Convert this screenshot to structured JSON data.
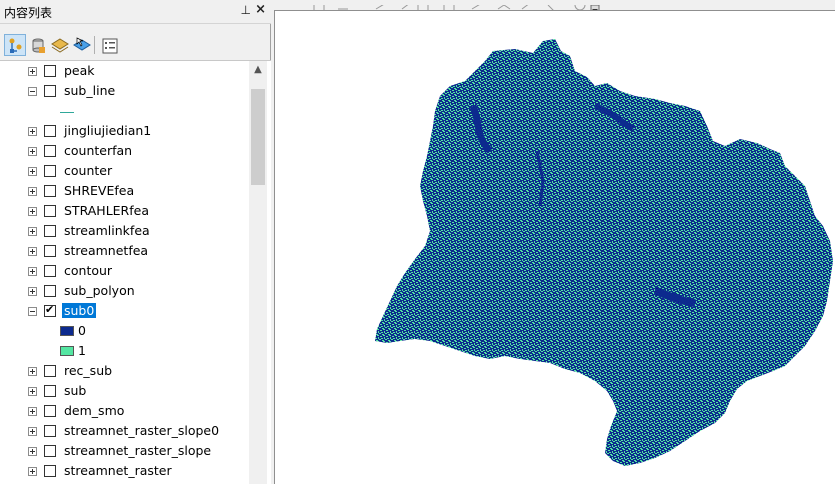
{
  "toc": {
    "title": "内容列表",
    "pin_icon": "pin-icon",
    "close_icon": "close-icon",
    "toolbar": [
      {
        "name": "list-by-drawing-order",
        "icon": "drawing-order-icon",
        "active": true
      },
      {
        "name": "list-by-source",
        "icon": "source-icon"
      },
      {
        "name": "list-by-visibility",
        "icon": "visibility-icon"
      },
      {
        "name": "list-by-selection",
        "icon": "selection-icon"
      },
      {
        "name": "options",
        "icon": "options-icon"
      }
    ],
    "layers": [
      {
        "name": "peak",
        "expanded": false,
        "checked": false
      },
      {
        "name": "sub_line",
        "expanded": true,
        "checked": false
      },
      {
        "name": "jingliujiedian1",
        "expanded": false,
        "checked": false
      },
      {
        "name": "counterfan",
        "expanded": false,
        "checked": false
      },
      {
        "name": "counter",
        "expanded": false,
        "checked": false
      },
      {
        "name": "SHREVEfea",
        "expanded": false,
        "checked": false
      },
      {
        "name": "STRAHLERfea",
        "expanded": false,
        "checked": false
      },
      {
        "name": "streamlinkfea",
        "expanded": false,
        "checked": false
      },
      {
        "name": "streamnetfea",
        "expanded": false,
        "checked": false
      },
      {
        "name": "contour",
        "expanded": false,
        "checked": false
      },
      {
        "name": "sub_polyon",
        "expanded": false,
        "checked": false
      },
      {
        "name": "sub0",
        "expanded": true,
        "checked": true,
        "selected": true
      },
      {
        "name": "rec_sub",
        "expanded": false,
        "checked": false
      },
      {
        "name": "sub",
        "expanded": false,
        "checked": false
      },
      {
        "name": "dem_smo",
        "expanded": false,
        "checked": false
      },
      {
        "name": "streamnet_raster_slope0",
        "expanded": false,
        "checked": false
      },
      {
        "name": "streamnet_raster_slope",
        "expanded": false,
        "checked": false
      },
      {
        "name": "streamnet_raster",
        "expanded": false,
        "checked": false
      }
    ],
    "sub0_legend": [
      {
        "value": "0",
        "color": "#0c2a8e"
      },
      {
        "value": "1",
        "color": "#54e6a2"
      }
    ],
    "sub_line_symbol_color": "#2fa89a"
  },
  "map": {
    "colors": {
      "class0": "#0c2a8e",
      "class1": "#54e6a2",
      "background": "#ffffff"
    }
  }
}
